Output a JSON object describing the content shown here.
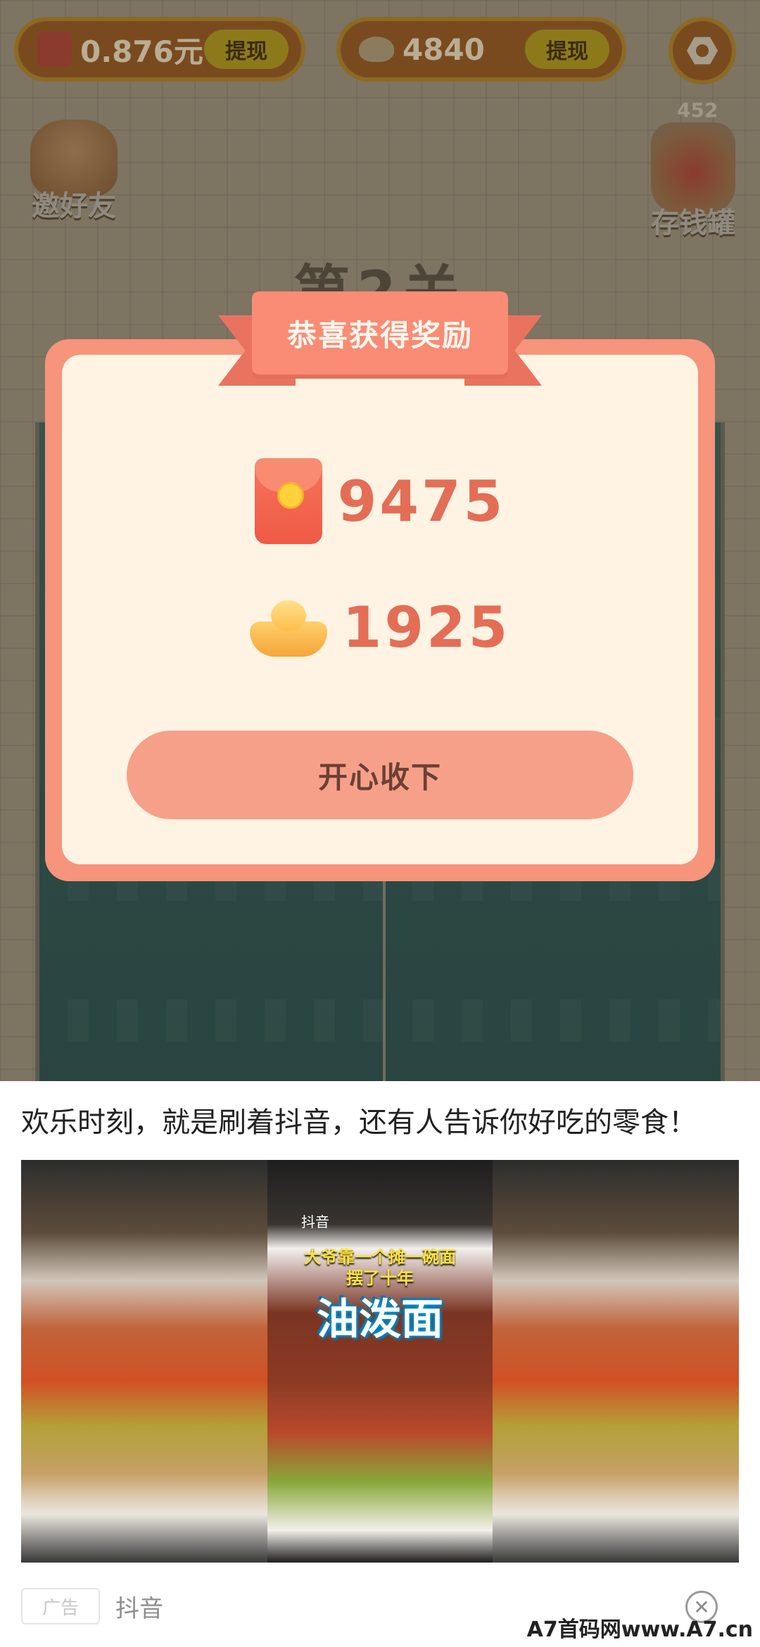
{
  "header": {
    "cash_value": "0.876元",
    "cash_withdraw": "提现",
    "gold_value": "4840",
    "gold_withdraw": "提现"
  },
  "sidebar": {
    "invite_label": "邀好友",
    "bank_label": "存钱罐",
    "bank_count": "452"
  },
  "level_title": "第2关",
  "reward_modal": {
    "ribbon_title": "恭喜获得奖励",
    "redpacket_amount": "9475",
    "gold_amount": "1925",
    "accept_label": "开心收下"
  },
  "ad": {
    "title": "欢乐时刻，就是刷着抖音，还有人告诉你好吃的零食！",
    "video_brand": "抖音",
    "video_subtitle_1": "大爷靠一个摊一碗面",
    "video_subtitle_2": "摆了十年",
    "video_big_title": "油泼面",
    "tag": "广告",
    "source": "抖音",
    "close_icon": "✕"
  },
  "watermark": "A7首码网www.A7.cn",
  "colors": {
    "modal_border": "#f6947c",
    "modal_bg": "#fff3e3",
    "ribbon": "#fa8b74",
    "reward_number": "#e46d56",
    "accept_button": "#f7a089"
  }
}
